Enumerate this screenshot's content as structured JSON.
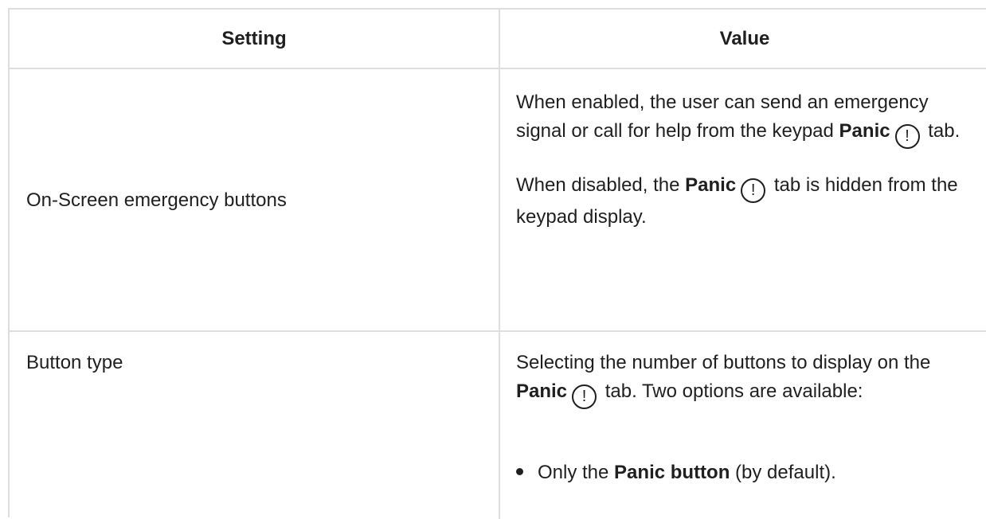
{
  "table": {
    "headers": {
      "setting": "Setting",
      "value": "Value"
    },
    "rows": [
      {
        "setting": "On-Screen emergency buttons",
        "value": {
          "p1_pre": "When enabled, the user can send an emergency signal or call for help from the keypad ",
          "p1_bold": "Panic",
          "p1_post": " tab.",
          "p2_pre": "When disabled, the ",
          "p2_bold": "Panic",
          "p2_post": " tab is hidden from the keypad display."
        }
      },
      {
        "setting": "Button type",
        "value": {
          "p1_pre": "Selecting the number of buttons to display on the ",
          "p1_bold": "Panic",
          "p1_post": " tab. Two options are available:",
          "bullet_pre": "Only the ",
          "bullet_bold": "Panic button",
          "bullet_post": " (by default)."
        }
      }
    ],
    "icon_glyph": "!"
  }
}
